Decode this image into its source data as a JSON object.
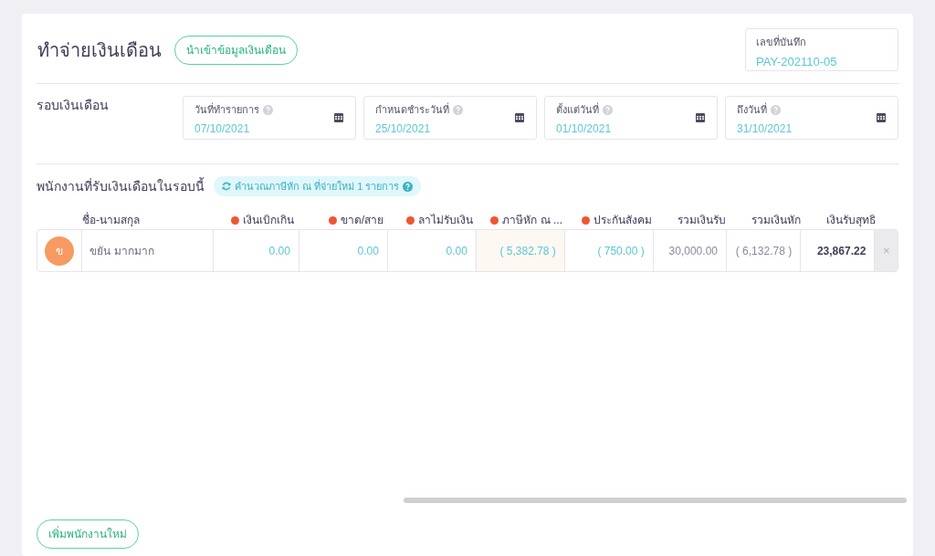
{
  "header": {
    "title": "ทำจ่ายเงินเดือน",
    "import_button": "นำเข้าข้อมูลเงินเดือน",
    "record": {
      "label": "เลขที่บันทึก",
      "value": "PAY-202110-05"
    }
  },
  "period": {
    "label": "รอบเงินเดือน",
    "fields": [
      {
        "label": "วันที่ทำรายการ",
        "value": "07/10/2021"
      },
      {
        "label": "กำหนดชำระวันที่",
        "value": "25/10/2021"
      },
      {
        "label": "ตั้งแต่วันที่",
        "value": "01/10/2021"
      },
      {
        "label": "ถึงวันที่",
        "value": "31/10/2021"
      }
    ]
  },
  "employees": {
    "title": "พนักงานที่รับเงินเดือนในรอบนี้",
    "recalc_badge": "คำนวณภาษีหัก ณ ที่จ่ายใหม่ 1 รายการ",
    "columns": [
      {
        "label": "ชื่อ-นามสกุล",
        "dot": false
      },
      {
        "label": "เงินเบิกเกิน",
        "dot": true
      },
      {
        "label": "ขาด/สาย",
        "dot": true
      },
      {
        "label": "ลาไม่รับเงิน",
        "dot": true
      },
      {
        "label": "ภาษีหัก ณ ...",
        "dot": true
      },
      {
        "label": "ประกันสังคม",
        "dot": true
      },
      {
        "label": "รวมเงินรับ",
        "dot": false
      },
      {
        "label": "รวมเงินหัก",
        "dot": false
      },
      {
        "label": "เงินรับสุทธิ",
        "dot": false
      }
    ],
    "rows": [
      {
        "initial": "ข",
        "cells": [
          {
            "kind": "name",
            "text": "ขยัน มากมาก"
          },
          {
            "kind": "input",
            "text": "0.00"
          },
          {
            "kind": "input",
            "text": "0.00"
          },
          {
            "kind": "input",
            "text": "0.00"
          },
          {
            "kind": "focused",
            "text": "( 5,382.78 )"
          },
          {
            "kind": "input",
            "text": "( 750.00 )"
          },
          {
            "kind": "total",
            "text": "30,000.00"
          },
          {
            "kind": "total",
            "text": "( 6,132.78 )"
          },
          {
            "kind": "net",
            "text": "23,867.22"
          }
        ],
        "remove": "×"
      }
    ]
  },
  "add_button": "เพิ่มพนักงานใหม่"
}
